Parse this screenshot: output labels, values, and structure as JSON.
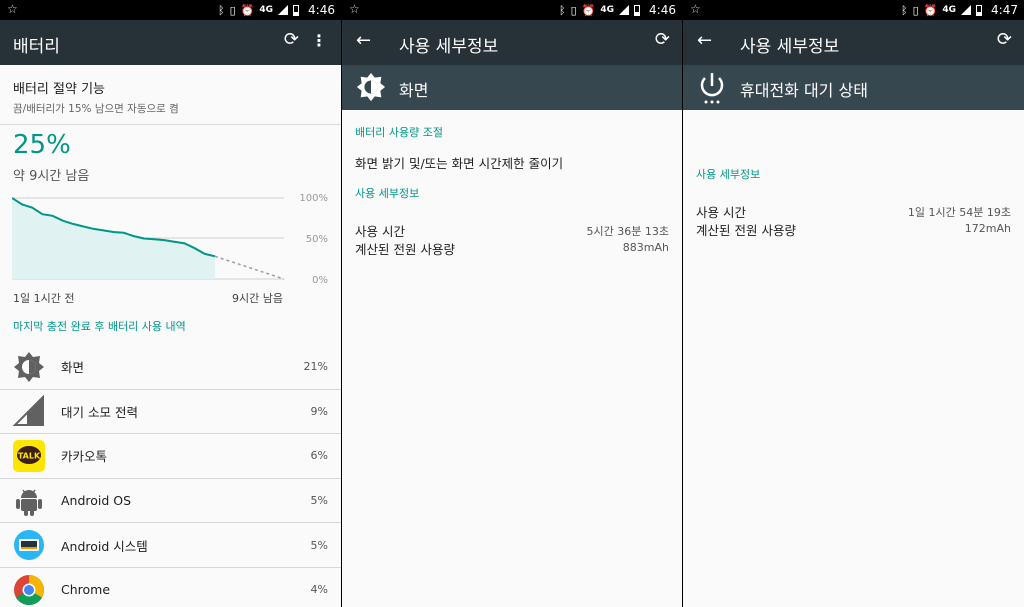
{
  "panel1": {
    "status_time": "4:46",
    "network": "4G",
    "title": "배터리",
    "saver_title": "배터리 절약 기능",
    "saver_sub": "끔/배터리가 15% 남으면 자동으로 켬",
    "percent": "25%",
    "remaining": "약 9시간 남음",
    "chart": {
      "type": "line",
      "y_ticks": [
        "100%",
        "50%",
        "0%"
      ],
      "x_start": "1일 1시간 전",
      "x_end": "9시간 남음",
      "values": [
        100,
        92,
        88,
        80,
        78,
        72,
        68,
        65,
        62,
        60,
        58,
        57,
        53,
        50,
        49,
        48,
        46,
        44,
        38,
        31,
        28
      ]
    },
    "section": "마지막 충전 완료 후 배터리 사용 내역",
    "apps": [
      {
        "name": "화면",
        "value": "21%",
        "icon": "brightness-icon"
      },
      {
        "name": "대기 소모 전력",
        "value": "9%",
        "icon": "cell-signal-icon"
      },
      {
        "name": "카카오톡",
        "value": "6%",
        "icon": "kakaotalk-icon",
        "badge": "TALK"
      },
      {
        "name": "Android OS",
        "value": "5%",
        "icon": "android-icon"
      },
      {
        "name": "Android 시스템",
        "value": "5%",
        "icon": "android-system-icon"
      },
      {
        "name": "Chrome",
        "value": "4%",
        "icon": "chrome-icon"
      }
    ]
  },
  "panel2": {
    "status_time": "4:46",
    "network": "4G",
    "title": "사용 세부정보",
    "hero": "화면",
    "section1": "배터리 사용량 조절",
    "action": "화면 밝기 및/또는 화면 시간제한 줄이기",
    "section2": "사용 세부정보",
    "usage_label": "사용 시간",
    "usage_value": "5시간 36분 13초",
    "power_label": "계산된 전원 사용량",
    "power_value": "883mAh"
  },
  "panel3": {
    "status_time": "4:47",
    "network": "4G",
    "title": "사용 세부정보",
    "hero": "휴대전화 대기 상태",
    "section": "사용 세부정보",
    "usage_label": "사용 시간",
    "usage_value": "1일 1시간 54분 19초",
    "power_label": "계산된 전원 사용량",
    "power_value": "172mAh"
  },
  "colors": {
    "accent": "#009688",
    "appbar": "#263238",
    "hero": "#37474f"
  }
}
